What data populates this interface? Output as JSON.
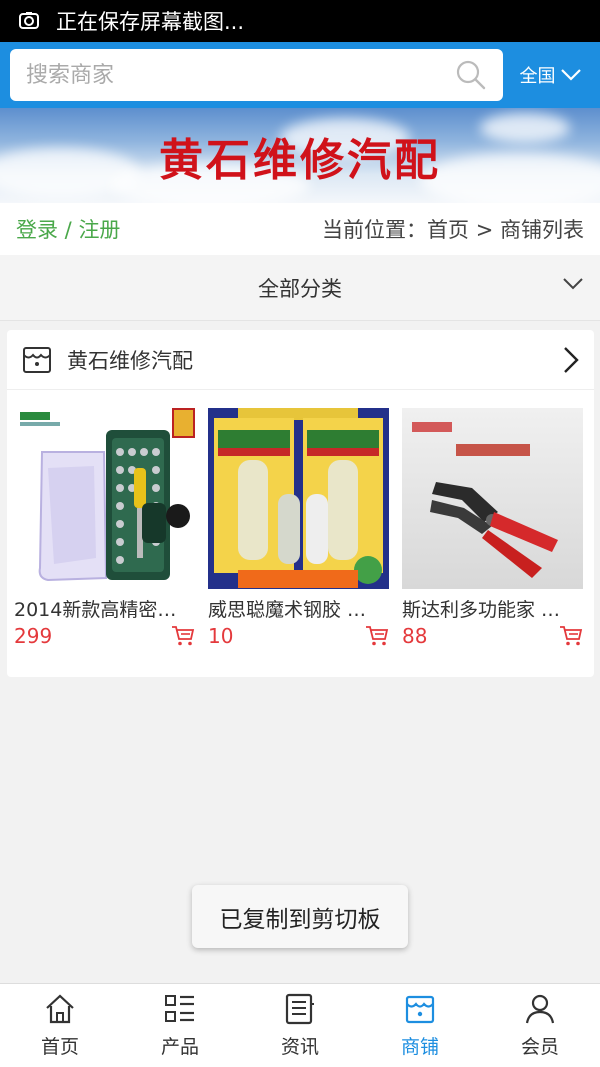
{
  "status_bar": {
    "text": "正在保存屏幕截图..."
  },
  "search": {
    "placeholder": "搜索商家",
    "region": "全国"
  },
  "banner": {
    "title": "黄石维修汽配"
  },
  "nav": {
    "login": "登录",
    "separator": " / ",
    "register": "注册",
    "location_prefix": "当前位置：",
    "home": "首页",
    "arrow": " > ",
    "current": "商铺列表"
  },
  "category": {
    "label": "全部分类"
  },
  "store": {
    "name": "黄石维修汽配",
    "products": [
      {
        "name": "2014新款高精密…",
        "price": "299"
      },
      {
        "name": "威思聪魔术钢胶 …",
        "price": "10"
      },
      {
        "name": "斯达利多功能家 …",
        "price": "88"
      }
    ]
  },
  "toast": {
    "text": "已复制到剪切板"
  },
  "tabbar": {
    "items": [
      {
        "label": "首页",
        "icon": "home-icon"
      },
      {
        "label": "产品",
        "icon": "grid-list-icon"
      },
      {
        "label": "资讯",
        "icon": "news-icon"
      },
      {
        "label": "商铺",
        "icon": "store-icon",
        "active": true
      },
      {
        "label": "会员",
        "icon": "user-icon"
      }
    ]
  },
  "colors": {
    "primary": "#1d8ee0",
    "banner_text": "#d0121a",
    "price": "#e4393c",
    "auth_link": "#4aa84a"
  }
}
